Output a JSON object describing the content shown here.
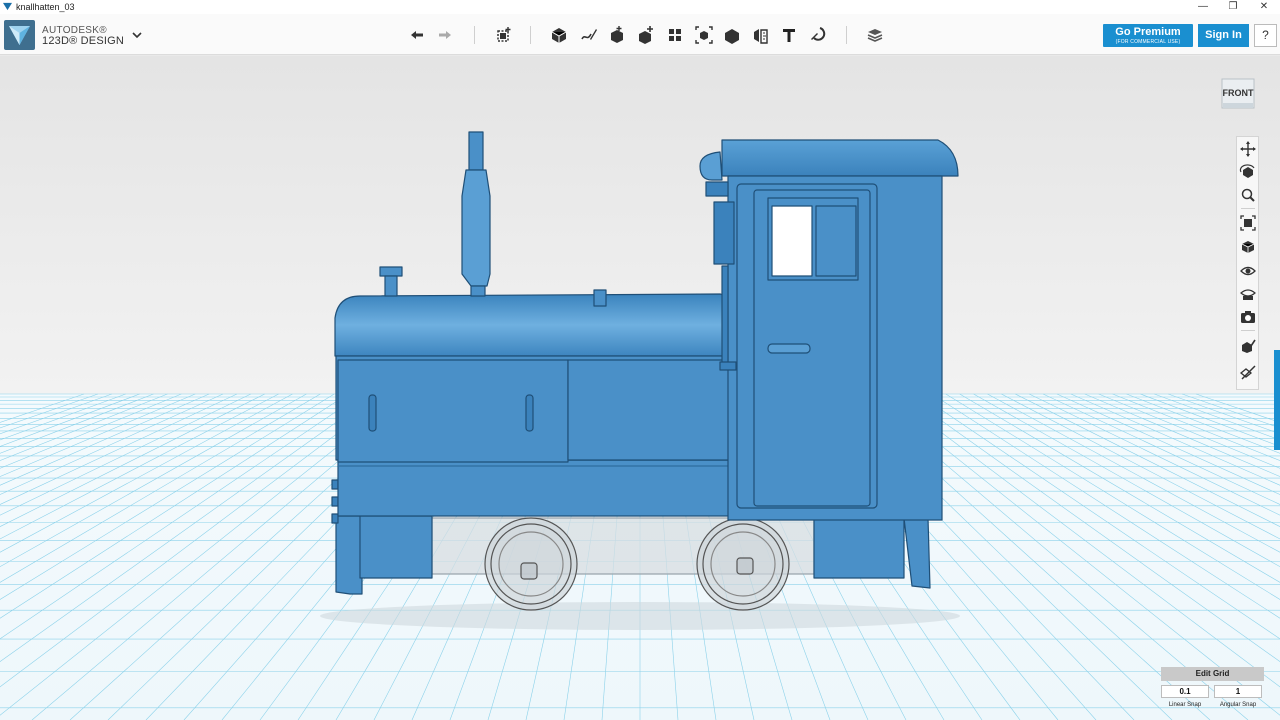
{
  "window": {
    "title": "knallhatten_03",
    "controls": [
      "minimize-icon",
      "maximize-icon",
      "close-icon"
    ]
  },
  "brand": {
    "line1": "AUTODESK®",
    "line2": "123D® DESIGN"
  },
  "toolbar": {
    "icons": [
      "undo-icon",
      "redo-icon",
      "transform-icon",
      "primitives-icon",
      "sketch-icon",
      "construct-icon",
      "modify-icon",
      "pattern-icon",
      "grouping-icon",
      "combine-icon",
      "measure-icon",
      "text-icon",
      "snap-icon",
      "material-icon"
    ],
    "premium_label": "Go Premium",
    "premium_sub": "(FOR COMMERCIAL USE)",
    "signin_label": "Sign In",
    "help_label": "?"
  },
  "viewcube": {
    "face_label": "FRONT"
  },
  "navbar": {
    "icons": [
      "pan-icon",
      "orbit-icon",
      "zoom-icon",
      "fit-icon",
      "view-mode-icon",
      "visibility-icon",
      "materials-visibility-icon",
      "screenshot-icon",
      "outline-icon",
      "snap-visibility-icon"
    ]
  },
  "grid": {
    "edit_label": "Edit Grid",
    "linear_snap_value": "0.1",
    "angular_snap_value": "1",
    "linear_snap_label": "Linear Snap",
    "angular_snap_label": "Angular Snap"
  },
  "colors": {
    "model_blue": "#4a90c8",
    "model_dark": "#2e6d9e",
    "accent": "#1a8fd0",
    "grid_line": "#8cd2ea"
  }
}
